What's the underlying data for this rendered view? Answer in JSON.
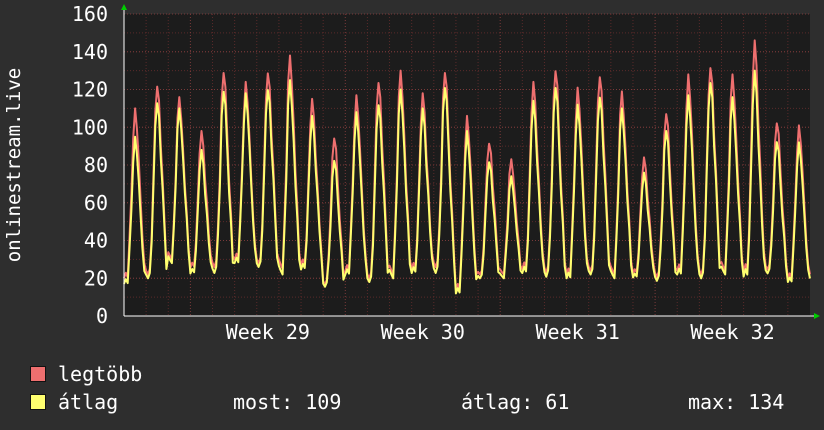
{
  "chart_data": {
    "type": "line",
    "ylabel": "onlinestream.live",
    "ylim": [
      0,
      160
    ],
    "yticks": [
      0,
      20,
      40,
      60,
      80,
      100,
      120,
      140,
      160
    ],
    "xlabels": [
      "Week 29",
      "Week 30",
      "Week 31",
      "Week 32"
    ],
    "grid": true,
    "colors": {
      "background": "#2e2e2e",
      "plot": "#1c1c1c",
      "grid_minor": "#5a2a2a",
      "grid_major": "#7a3a3a",
      "axis_arrow": "#00cc00",
      "max_series": "#ee6f6f",
      "avg_series": "#ffff6f"
    },
    "days": 31,
    "daily_peaks": {
      "legtobb": [
        110,
        124,
        116,
        98,
        130,
        124,
        131,
        138,
        115,
        95,
        117,
        126,
        130,
        118,
        130,
        106,
        93,
        83,
        124,
        131,
        121,
        129,
        119,
        84,
        108,
        128,
        134,
        128,
        146,
        103,
        101,
        124
      ],
      "atlag": [
        95,
        115,
        110,
        88,
        120,
        118,
        122,
        125,
        106,
        83,
        108,
        114,
        120,
        110,
        122,
        98,
        83,
        74,
        114,
        122,
        112,
        118,
        110,
        76,
        99,
        117,
        126,
        116,
        130,
        93,
        92,
        112
      ]
    },
    "daily_mins": {
      "legtobb": [
        20,
        22,
        30,
        25,
        25,
        30,
        28,
        25,
        26,
        16,
        24,
        20,
        22,
        24,
        25,
        14,
        22,
        22,
        24,
        22,
        22,
        24,
        22,
        22,
        20,
        24,
        22,
        24,
        22,
        24,
        20
      ],
      "atlag": [
        17,
        20,
        28,
        22,
        22,
        28,
        26,
        22,
        24,
        15,
        22,
        18,
        20,
        22,
        22,
        12,
        20,
        20,
        22,
        20,
        20,
        22,
        20,
        20,
        18,
        22,
        20,
        22,
        20,
        22,
        18
      ]
    },
    "series": [
      {
        "name": "legtöbb",
        "color": "#ee6f6f"
      },
      {
        "name": "átlag",
        "color": "#ffff6f"
      }
    ]
  },
  "legend": {
    "max_label": "legtöbb",
    "avg_label": "átlag"
  },
  "stats": {
    "most": "most: 109",
    "atlag": "átlag: 61",
    "max": "max: 134"
  }
}
